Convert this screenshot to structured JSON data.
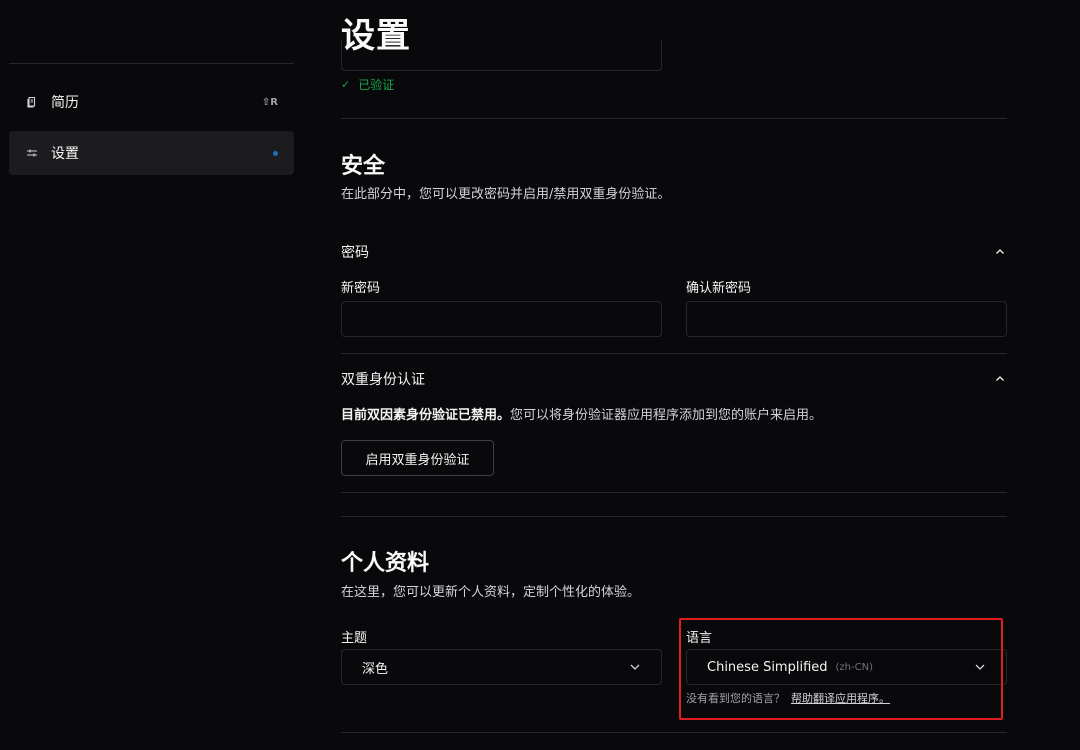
{
  "sidebar": {
    "items": [
      {
        "label": "简历",
        "icon": "resume-icon",
        "shortcut": "⇧R",
        "active": false
      },
      {
        "label": "设置",
        "icon": "sliders-icon",
        "active": true
      }
    ]
  },
  "header": {
    "title": "设置"
  },
  "account": {
    "verified_text": "已验证"
  },
  "security": {
    "title": "安全",
    "description": "在此部分中，您可以更改密码并启用/禁用双重身份验证。",
    "password": {
      "heading": "密码",
      "new_password_label": "新密码",
      "confirm_password_label": "确认新密码",
      "new_password_value": "",
      "confirm_password_value": ""
    },
    "two_factor": {
      "heading": "双重身份认证",
      "status_bold": "目前双因素身份验证已禁用。",
      "status_rest": "您可以将身份验证器应用程序添加到您的账户来启用。",
      "enable_button": "启用双重身份验证"
    }
  },
  "profile": {
    "title": "个人资料",
    "description": "在这里，您可以更新个人资料，定制个性化的体验。",
    "theme": {
      "label": "主题",
      "value": "深色"
    },
    "language": {
      "label": "语言",
      "value": "Chinese Simplified",
      "code": "(zh-CN)",
      "hint": "没有看到您的语言？",
      "hint_link": "帮助翻译应用程序。"
    }
  },
  "colors": {
    "background": "#09090b",
    "border": "#27272a",
    "verified": "#16a34a",
    "active_dot": "#1e6fb8",
    "highlight": "#e11d24"
  }
}
